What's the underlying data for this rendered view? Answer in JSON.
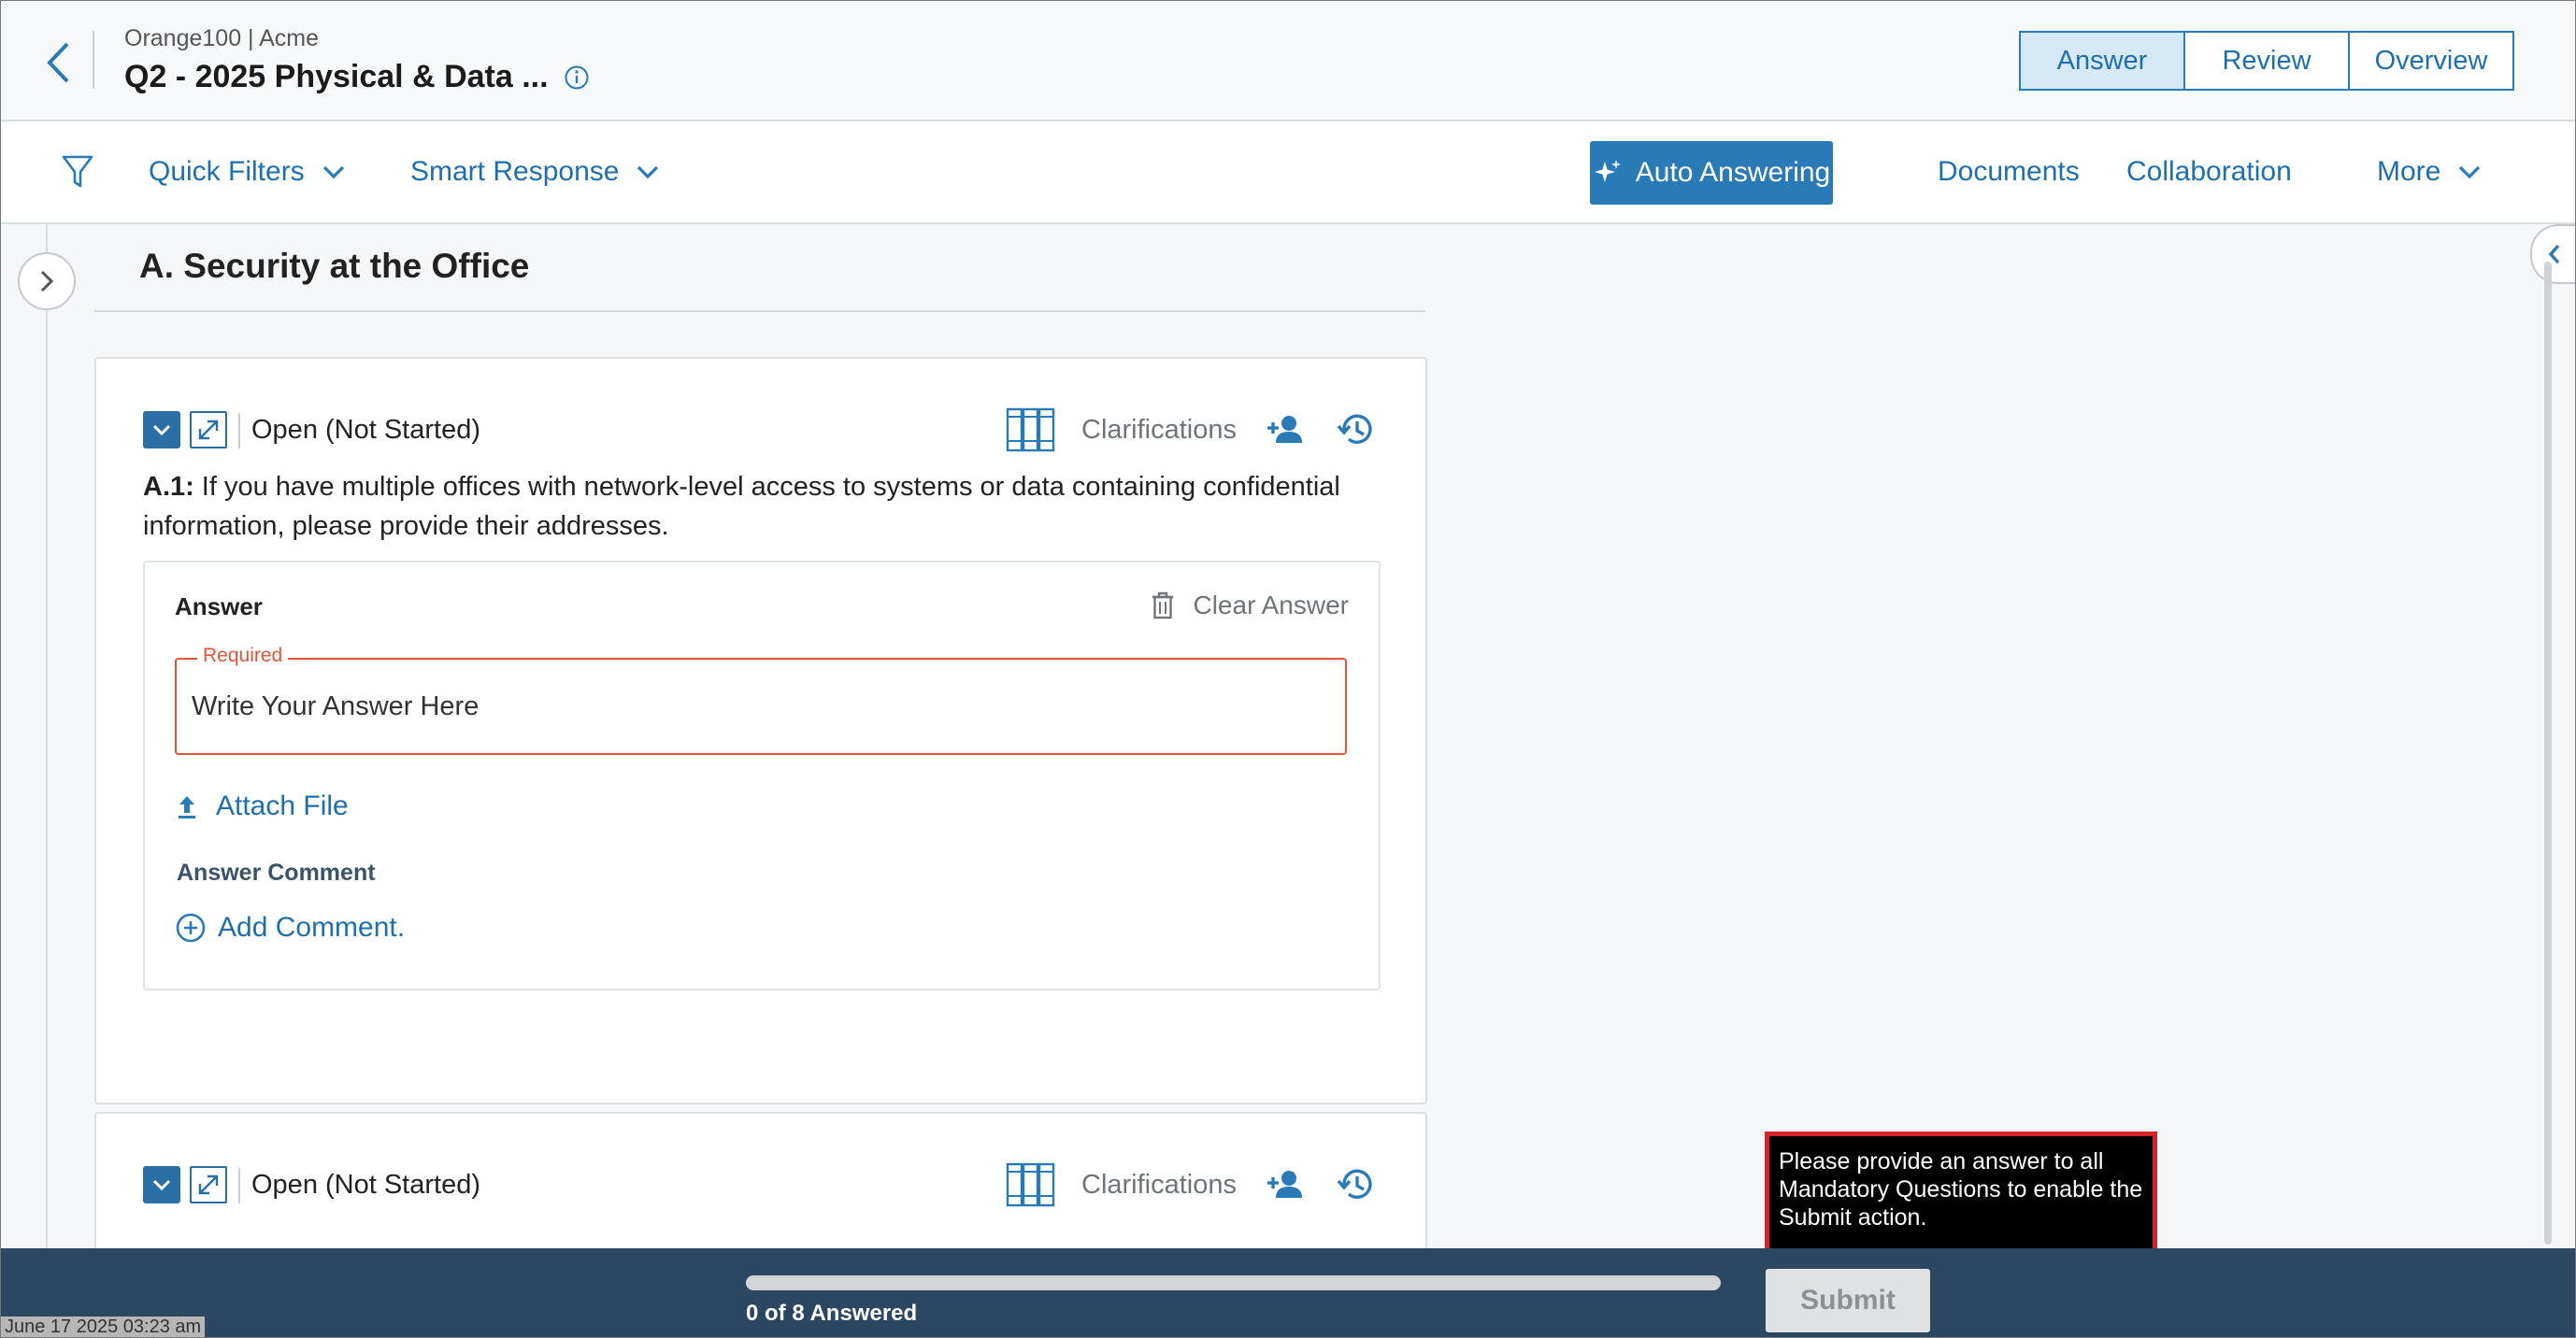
{
  "header": {
    "breadcrumb": "Orange100 | Acme",
    "title": "Q2 - 2025 Physical & Data ...",
    "tabs": [
      {
        "label": "Answer",
        "active": true
      },
      {
        "label": "Review",
        "active": false
      },
      {
        "label": "Overview",
        "active": false
      }
    ]
  },
  "toolbar": {
    "filter_icon": "funnel-icon",
    "quick_filters": "Quick Filters",
    "smart_response": "Smart Response",
    "auto_answering": "Auto Answering",
    "documents": "Documents",
    "collaboration": "Collaboration",
    "more": "More"
  },
  "section": {
    "title": "A. Security at the Office"
  },
  "questions": [
    {
      "status": "Open (Not Started)",
      "clarifications": "Clarifications",
      "number": "A.1:",
      "text": "If you have multiple offices with network-level access to systems or data containing confidential information, please provide their addresses.",
      "answer_label": "Answer",
      "clear_answer": "Clear Answer",
      "required_label": "Required",
      "answer_placeholder": "Write Your Answer Here",
      "attach_file": "Attach File",
      "comment_label": "Answer Comment",
      "add_comment": "Add Comment."
    },
    {
      "status": "Open (Not Started)",
      "clarifications": "Clarifications"
    }
  ],
  "tooltip": {
    "text": "Please provide an answer to all Mandatory Questions to enable the Submit action."
  },
  "footer": {
    "progress_text": "0 of 8 Answered",
    "progress_fraction": 0,
    "submit_label": "Submit",
    "timestamp": "June 17 2025 03:23 am"
  },
  "colors": {
    "accent": "#2a7ab8",
    "link": "#1f6fae",
    "required": "#e2553c",
    "footer_bg": "#2c4761",
    "tooltip_border": "#d2232a"
  }
}
